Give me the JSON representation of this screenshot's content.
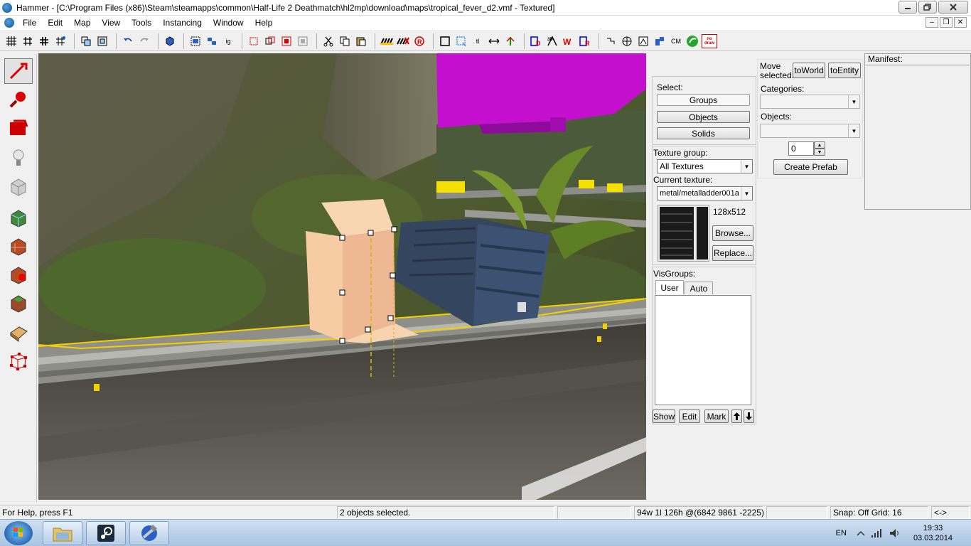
{
  "window": {
    "title": "Hammer - [C:\\Program Files (x86)\\Steam\\steamapps\\common\\Half-Life 2 Deathmatch\\hl2mp\\download\\maps\\tropical_fever_d2.vmf - Textured]",
    "minimize": "0",
    "maximize": "1",
    "close": "r"
  },
  "menu": {
    "items": [
      "File",
      "Edit",
      "Map",
      "View",
      "Tools",
      "Instancing",
      "Window",
      "Help"
    ],
    "mdi_min": "–",
    "mdi_restore": "❐",
    "mdi_close": "✕"
  },
  "toolbar": {
    "tl_label": "tl",
    "cm_label": "CM",
    "nodraw_label": "no draw"
  },
  "select_panel": {
    "label": "Select:",
    "groups": "Groups",
    "objects": "Objects",
    "solids": "Solids"
  },
  "move_panel": {
    "label_line1": "Move",
    "label_line2": "selected:",
    "to_world": "toWorld",
    "to_entity": "toEntity",
    "categories_label": "Categories:",
    "objects_label": "Objects:",
    "spin_value": "0",
    "create_prefab": "Create Prefab"
  },
  "manifest": {
    "label": "Manifest:"
  },
  "texture_panel": {
    "group_label": "Texture group:",
    "group_value": "All Textures",
    "current_label": "Current texture:",
    "current_value": "metal/metalladder001a",
    "size": "128x512",
    "browse": "Browse...",
    "replace": "Replace..."
  },
  "visgroups": {
    "label": "VisGroups:",
    "tab_user": "User",
    "tab_auto": "Auto",
    "show": "Show",
    "edit": "Edit",
    "mark": "Mark",
    "up": "🡅",
    "down": "🡇"
  },
  "status": {
    "help": "For Help, press F1",
    "selection": "2 objects selected.",
    "coords": "94w 1l 126h @(6842 9861 -2225)",
    "snap": "Snap: Off Grid: 16",
    "arrows": "<->"
  },
  "taskbar": {
    "lang": "EN",
    "time": "19:33",
    "date": "03.03.2014"
  },
  "colors": {
    "selection_fill": "#f5c9a3",
    "magenta_brush": "#c40fcf",
    "selection_outline": "#f5d000",
    "crate": "#34465f"
  }
}
